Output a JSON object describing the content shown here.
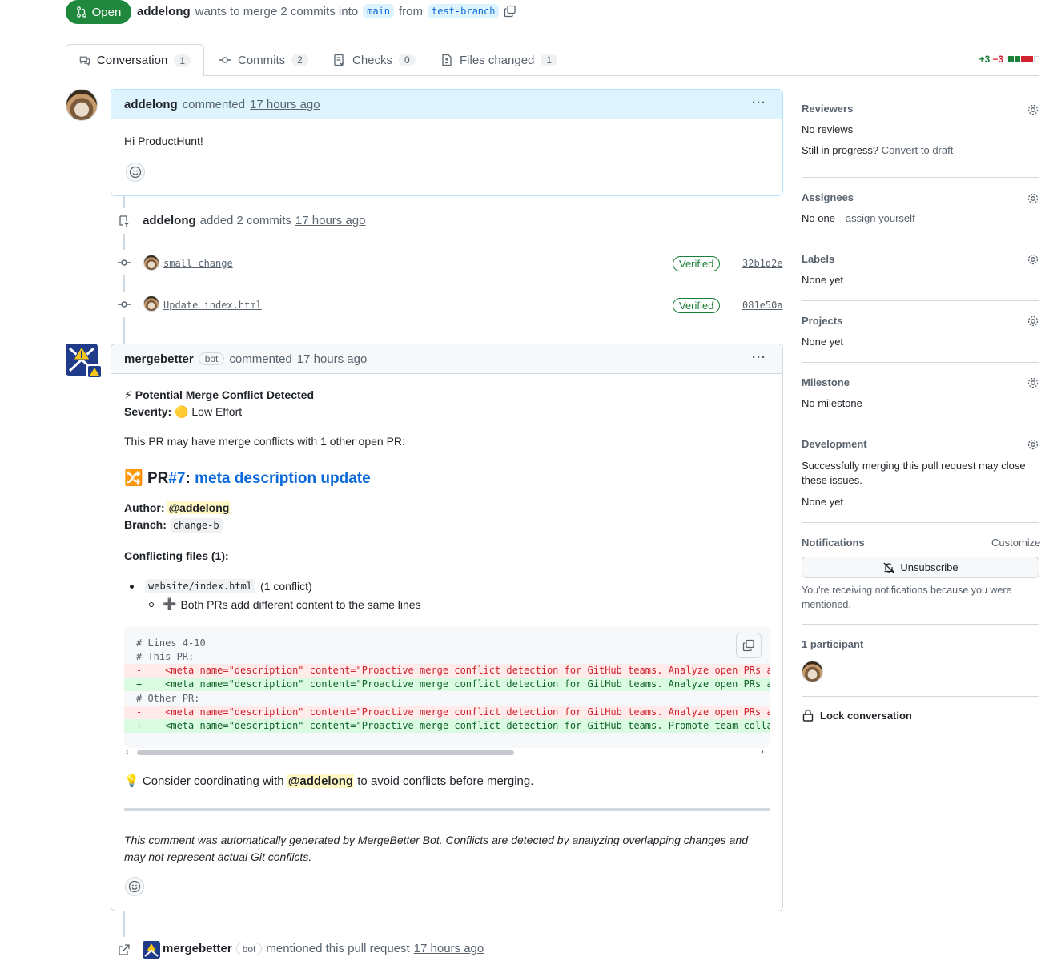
{
  "header": {
    "state": "Open",
    "author": "addelong",
    "summary": "wants to merge 2 commits into",
    "base_branch": "main",
    "from_word": "from",
    "head_branch": "test-branch"
  },
  "tabs": [
    {
      "label": "Conversation",
      "count": "1"
    },
    {
      "label": "Commits",
      "count": "2"
    },
    {
      "label": "Checks",
      "count": "0"
    },
    {
      "label": "Files changed",
      "count": "1"
    }
  ],
  "diffstat": {
    "additions": "+3",
    "deletions": "−3",
    "add_color": "#1a7f37",
    "del_color": "#d1242f"
  },
  "comment1": {
    "author": "addelong",
    "action": "commented",
    "time": "17 hours ago",
    "body": "Hi ProductHunt!"
  },
  "commits_event": {
    "author": "addelong",
    "action": "added 2 commits",
    "time": "17 hours ago",
    "commits": [
      {
        "message": "small change",
        "badge": "Verified",
        "sha": "32b1d2e"
      },
      {
        "message": "Update index.html",
        "badge": "Verified",
        "sha": "081e50a"
      }
    ]
  },
  "bot_comment": {
    "author": "mergebetter",
    "bot_label": "bot",
    "action": "commented",
    "time": "17 hours ago",
    "title_emoji": "⚡",
    "title": "Potential Merge Conflict Detected",
    "severity_label": "Severity:",
    "severity_emoji": "🟡",
    "severity_value": "Low Effort",
    "intro": "This PR may have merge conflicts with 1 other open PR:",
    "pr_emoji": "🔀",
    "pr_prefix": "PR",
    "pr_number": "#7",
    "pr_colon": ":",
    "pr_title": "meta description update",
    "author_label": "Author:",
    "author_value": "@addelong",
    "branch_label": "Branch:",
    "branch_value": "change-b",
    "conflicting_title": "Conflicting files (1):",
    "file_name": "website/index.html",
    "file_note": "(1 conflict)",
    "sub_emoji": "➕",
    "sub_note": "Both PRs add different content to the same lines",
    "code_lines": [
      "# Lines 4-10",
      "# This PR:",
      "-    <meta name=\"description\" content=\"Proactive merge conflict detection for GitHub teams. Analyze open PRs an",
      "+    <meta name=\"description\" content=\"Proactive merge conflict detection for GitHub teams. Analyze open PRs an",
      "# Other PR:",
      "-    <meta name=\"description\" content=\"Proactive merge conflict detection for GitHub teams. Analyze open PRs an",
      "+    <meta name=\"description\" content=\"Proactive merge conflict detection for GitHub teams. Promote team collab"
    ],
    "tip_emoji": "💡",
    "tip_before": "Consider coordinating with",
    "tip_mention": "@addelong",
    "tip_after": "to avoid conflicts before merging.",
    "footer_line1": "This comment was automatically generated by MergeBetter Bot. Conflicts are detected by analyzing overlapping changes and",
    "footer_line2": "may not represent actual Git conflicts."
  },
  "mention_event": {
    "author": "mergebetter",
    "bot_label": "bot",
    "action": "mentioned this pull request",
    "time": "17 hours ago"
  },
  "sidebar": {
    "reviewers": {
      "title": "Reviewers",
      "value": "No reviews",
      "draft_prefix": "Still in progress?",
      "draft_link": "Convert to draft"
    },
    "assignees": {
      "title": "Assignees",
      "value_prefix": "No one—",
      "value_link": "assign yourself"
    },
    "labels": {
      "title": "Labels",
      "value": "None yet"
    },
    "projects": {
      "title": "Projects",
      "value": "None yet"
    },
    "milestone": {
      "title": "Milestone",
      "value": "No milestone"
    },
    "development": {
      "title": "Development",
      "line1": "Successfully merging this pull request may close",
      "line2": "these issues.",
      "value": "None yet"
    },
    "notifications": {
      "title": "Notifications",
      "customize": "Customize",
      "button": "Unsubscribe",
      "note1": "You're receiving notifications because you were",
      "note2": "mentioned."
    },
    "participants": {
      "title": "1 participant"
    },
    "lock": "Lock conversation"
  }
}
